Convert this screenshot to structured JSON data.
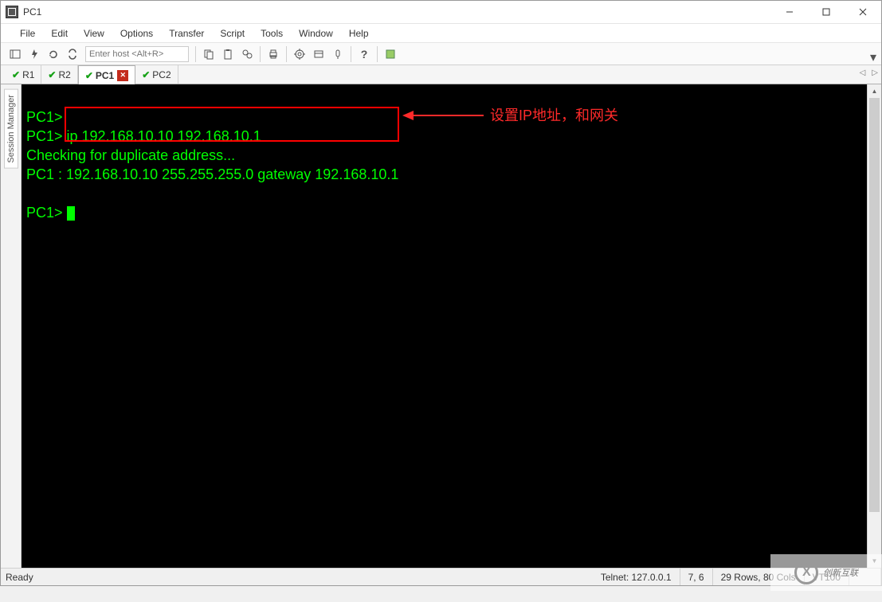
{
  "window": {
    "title": "PC1"
  },
  "menu": [
    "File",
    "Edit",
    "View",
    "Options",
    "Transfer",
    "Script",
    "Tools",
    "Window",
    "Help"
  ],
  "toolbar": {
    "host_placeholder": "Enter host <Alt+R>"
  },
  "sidebar": {
    "panel_label": "Session Manager"
  },
  "tabs": [
    {
      "name": "R1",
      "active": false,
      "closeable": false
    },
    {
      "name": "R2",
      "active": false,
      "closeable": false
    },
    {
      "name": "PC1",
      "active": true,
      "closeable": true
    },
    {
      "name": "PC2",
      "active": false,
      "closeable": false
    }
  ],
  "terminal": {
    "lines": [
      "PC1>",
      "PC1> ip 192.168.10.10 192.168.10.1",
      "Checking for duplicate address...",
      "PC1 : 192.168.10.10 255.255.255.0 gateway 192.168.10.1",
      "",
      "PC1> "
    ],
    "annotation": "设置IP地址，和网关"
  },
  "status": {
    "ready": "Ready",
    "connection": "Telnet: 127.0.0.1",
    "cursor": "7,   6",
    "size": "29 Rows, 80 Cols",
    "emulation": "VT100"
  },
  "watermark": "创新互联"
}
